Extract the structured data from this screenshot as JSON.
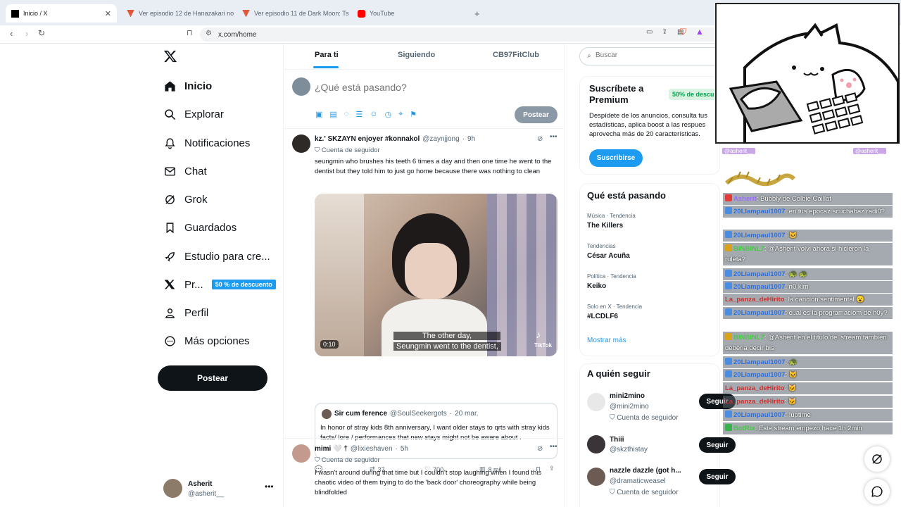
{
  "browser": {
    "tabs": [
      {
        "title": "Inicio / X",
        "active": true
      },
      {
        "title": "Ver episodio 12 de Hanazakari no Kimi",
        "active": false
      },
      {
        "title": "Ver episodio 11 de Dark Moon: Tsuki",
        "active": false
      },
      {
        "title": "YouTube",
        "active": false
      }
    ],
    "new_tab": "+",
    "url": "x.com/home"
  },
  "nav": {
    "items": [
      {
        "label": "Inicio",
        "icon": "home-icon"
      },
      {
        "label": "Explorar",
        "icon": "search-icon"
      },
      {
        "label": "Notificaciones",
        "icon": "bell-icon"
      },
      {
        "label": "Chat",
        "icon": "mail-icon"
      },
      {
        "label": "Grok",
        "icon": "grok-icon"
      },
      {
        "label": "Guardados",
        "icon": "bookmark-icon"
      },
      {
        "label": "Estudio para cre...",
        "icon": "rocket-icon"
      },
      {
        "label": "Pr...",
        "icon": "x-icon",
        "badge": "50 % de descuento"
      },
      {
        "label": "Perfil",
        "icon": "person-icon"
      },
      {
        "label": "Más opciones",
        "icon": "more-icon"
      }
    ],
    "post_button": "Postear",
    "account": {
      "name": "Asherit",
      "handle": "@asherit__"
    }
  },
  "center": {
    "tabs": [
      "Para ti",
      "Siguiendo",
      "CB97FitClub"
    ],
    "composer": {
      "placeholder": "¿Qué está pasando?",
      "post_button": "Postear"
    },
    "tweets": [
      {
        "name": "kz.' SKZAYN enjoyer #konnakol",
        "handle": "@zaynjjong",
        "time": "9h",
        "follower_label": "Cuenta de seguidor",
        "text": "seungmin who brushes his teeth 6 times a day and then one time he went to the dentist but they told him to just go home because there was nothing to clean",
        "video": {
          "duration": "0:10",
          "subtitle1": "The other day,",
          "subtitle2": "Seungmin went to the dentist,",
          "watermark": "TikTok"
        },
        "quote": {
          "name": "Sir cum ference",
          "handle": "@SoulSeekergots",
          "date": "20 mar.",
          "text": "In honor of stray kids 8th anniversary, I want older stays to qrts with stray kids facts/ lore / performances that new stays might not be aware about ."
        },
        "stats": {
          "retweets": "37",
          "likes": "700",
          "views": "8 mil"
        }
      },
      {
        "name": "mimi 🤍 †",
        "handle": "@lixieshaven",
        "time": "5h",
        "follower_label": "Cuenta de seguidor",
        "text": "I wasn't around during that time but I couldn't stop laughing when I found this chaotic video of them trying to do the 'back door' choreography while being blindfolded"
      }
    ]
  },
  "right": {
    "search_placeholder": "Buscar",
    "premium": {
      "title": "Suscríbete a Premium",
      "discount": "50% de descu",
      "desc": "Despídete de los anuncios, consulta tus estadísticas, aplica boost a las respues aprovecha más de 20 características.",
      "button": "Suscribirse"
    },
    "trends_title": "Qué está pasando",
    "trends": [
      {
        "category": "Música · Tendencia",
        "name": "The Killers"
      },
      {
        "category": "Tendencias",
        "name": "César Acuña"
      },
      {
        "category": "Política · Tendencia",
        "name": "Keiko"
      },
      {
        "category": "Solo en X · Tendencia",
        "name": "#LCDLF6"
      }
    ],
    "show_more": "Mostrar más",
    "follow_title": "A quién seguir",
    "follow": [
      {
        "name": "mini2mino",
        "handle": "@mini2mino",
        "sub": "Cuenta de seguidor",
        "button": "Seguir"
      },
      {
        "name": "Thiii",
        "handle": "@skzthistay",
        "sub": "",
        "button": "Seguir"
      },
      {
        "name": "nazzle dazzle (got h...",
        "handle": "@dramaticweasel",
        "sub": "Cuenta de seguidor",
        "button": "Seguir"
      }
    ]
  },
  "stream_chat": {
    "header_left": "@asherit__",
    "header_right": "@asherit__",
    "lines": [
      {
        "user": "Asherit",
        "msg": ": Bubbly de Colbie Caillat",
        "color": "purple",
        "badge": "red"
      },
      {
        "user": "20Llampaul1007",
        "msg": ": en tus epocaz scuchabaz radi0?",
        "color": "blue",
        "badge": "blue"
      },
      {
        "user": "20Llampaul1007",
        "msg": ": 🐱",
        "color": "blue",
        "badge": "blue"
      },
      {
        "user": "BINBINL7",
        "msg": ": @Asherit volvi ahora si hicieron la ruleta?",
        "color": "green",
        "badge": "gold"
      },
      {
        "user": "20Llampaul1007",
        "msg": ": 🐢 🐢",
        "color": "blue",
        "badge": "blue"
      },
      {
        "user": "20Llampaul1007",
        "msg": ": n0 kim",
        "color": "blue",
        "badge": "blue"
      },
      {
        "user": "La_panza_deHirito",
        "msg": ": la canción sentimental 😮",
        "color": "red",
        "badge": ""
      },
      {
        "user": "20Llampaul1007",
        "msg": ": cual es la programaciom de h0y?",
        "color": "blue",
        "badge": "blue"
      },
      {
        "user": "BINBINL7",
        "msg": ": @Asherit en el titulo del stream tambien deberia decir bls",
        "color": "green",
        "badge": "gold"
      },
      {
        "user": "20Llampaul1007",
        "msg": ": 🐢",
        "color": "blue",
        "badge": "blue"
      },
      {
        "user": "20Llampaul1007",
        "msg": ": 🐱",
        "color": "blue",
        "badge": "blue"
      },
      {
        "user": "La_panza_deHirito",
        "msg": ": 🐱",
        "color": "red",
        "badge": ""
      },
      {
        "user": "La_panza_deHirito",
        "msg": ": 🐱",
        "color": "red",
        "badge": ""
      },
      {
        "user": "20Llampaul1007",
        "msg": ": !uptime",
        "color": "blue",
        "badge": "blue"
      },
      {
        "user": "BotRix",
        "msg": ": Este stream empezo hace 1h 2min",
        "color": "green",
        "badge": "green"
      }
    ]
  }
}
